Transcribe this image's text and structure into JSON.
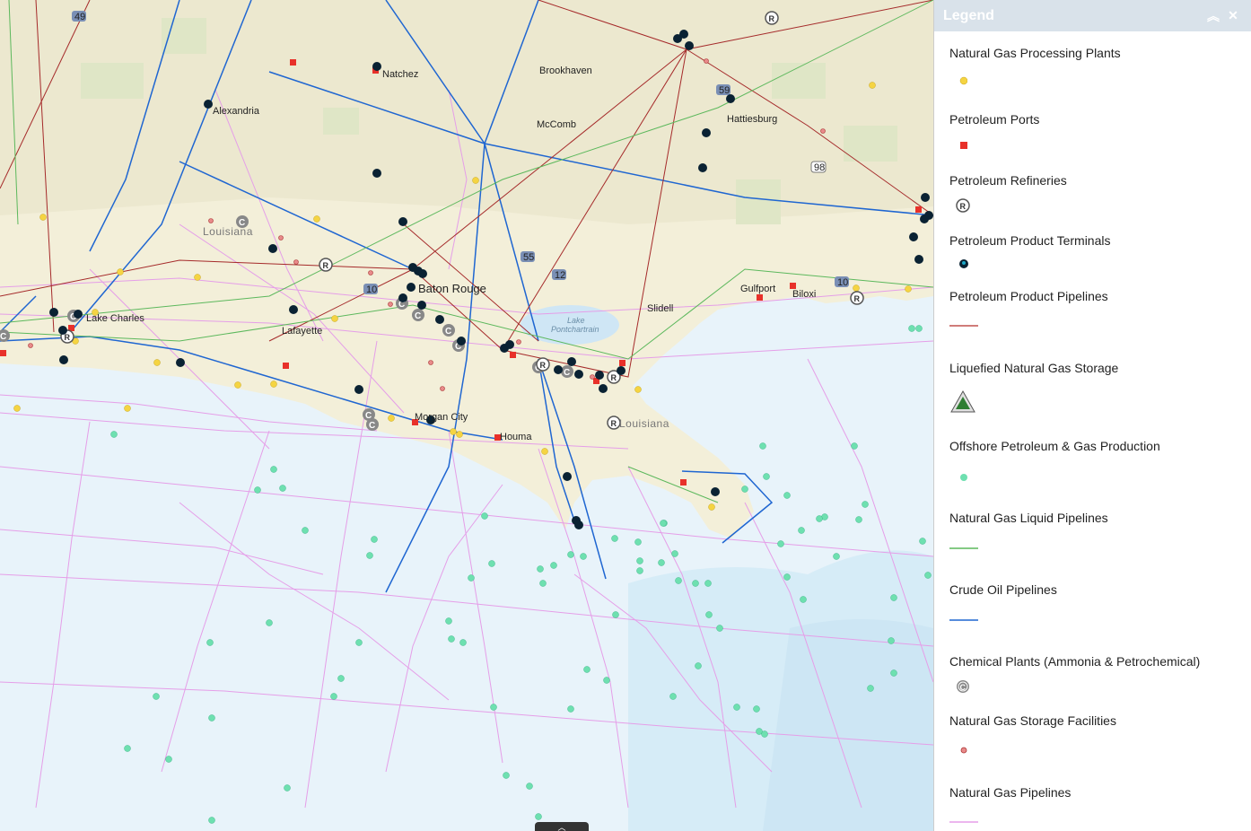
{
  "legend": {
    "title": "Legend",
    "collapse_icon": "chevron-double-up-icon",
    "close_icon": "close-icon",
    "items": [
      {
        "label": "Natural Gas Processing Plants",
        "symbol": "yellow-dot",
        "color": "#f5d442"
      },
      {
        "label": "Petroleum Ports",
        "symbol": "red-square",
        "color": "#e8312a"
      },
      {
        "label": "Petroleum Refineries",
        "symbol": "refinery-r-icon",
        "color": "#555555"
      },
      {
        "label": "Petroleum Product Terminals",
        "symbol": "terminal-drop-icon",
        "color": "#0a2233"
      },
      {
        "label": "Petroleum Product Pipelines",
        "symbol": "dark-red-line",
        "color": "#c0504d"
      },
      {
        "label": "Liquefied Natural Gas Storage",
        "symbol": "lng-triangle-icon",
        "color": "#2e7d32"
      },
      {
        "label": "Offshore Petroleum & Gas Production",
        "symbol": "mint-dot",
        "color": "#6ee0b0"
      },
      {
        "label": "Natural Gas Liquid Pipelines",
        "symbol": "green-line",
        "color": "#5cb85c"
      },
      {
        "label": "Crude Oil Pipelines",
        "symbol": "blue-line",
        "color": "#1f66d1"
      },
      {
        "label": "Chemical Plants (Ammonia & Petrochemical)",
        "symbol": "chemical-c-icon",
        "color": "#888888"
      },
      {
        "label": "Natural Gas Storage Facilities",
        "symbol": "pink-dot",
        "color": "#e88a8a"
      },
      {
        "label": "Natural Gas Pipelines",
        "symbol": "violet-line",
        "color": "#e59ee8"
      }
    ]
  },
  "map": {
    "cities": [
      "Natchez",
      "Brookhaven",
      "Alexandria",
      "McComb",
      "Hattiesburg",
      "Baton Rouge",
      "Lake Charles",
      "Lafayette",
      "Gulfport",
      "Biloxi",
      "Slidell",
      "Morgan City",
      "Houma"
    ],
    "states": [
      "Louisiana",
      "Louisiana"
    ],
    "water": [
      "Lake",
      "Pontchartrain"
    ],
    "highways": [
      "49",
      "55",
      "12",
      "10",
      "10",
      "98",
      "59"
    ]
  }
}
